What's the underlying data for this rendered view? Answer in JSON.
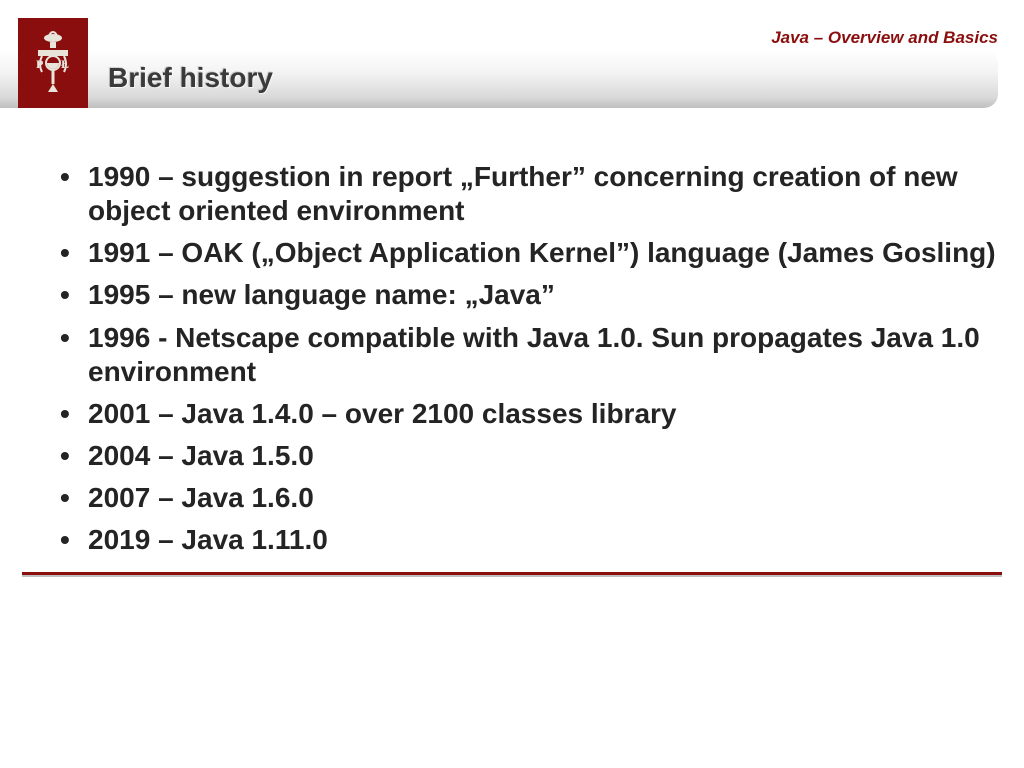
{
  "header": {
    "subtitle": "Java – Overview and Basics",
    "title": "Brief history"
  },
  "bullets": [
    "1990 – suggestion in report „Further” concerning creation of new object oriented environment",
    "1991 – OAK („Object Application Kernel”) language (James Gosling)",
    "1995 – new language name: „Java”",
    "1996 -  Netscape compatible with Java 1.0. Sun propagates Java 1.0 environment",
    "2001 – Java 1.4.0 – over 2100 classes library",
    "2004 – Java 1.5.0",
    "2007 – Java 1.6.0",
    "2019 – Java 1.11.0"
  ]
}
